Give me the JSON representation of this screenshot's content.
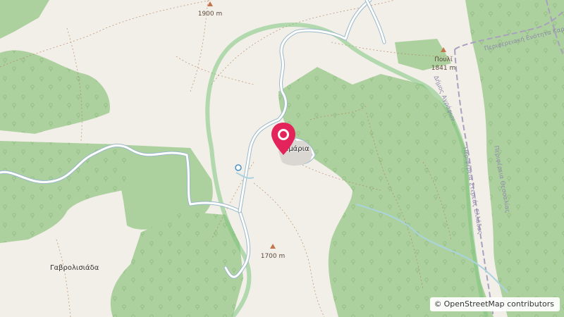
{
  "map": {
    "peaks": [
      {
        "name": "",
        "elevation": "1900 m"
      },
      {
        "name": "Πουλί",
        "elevation": "1841 m"
      },
      {
        "name": "",
        "elevation": "1700 m"
      }
    ],
    "places": [
      "Γαβρολισιάδα"
    ],
    "pin_label": "Σμάρια",
    "boundary_labels": [
      "Περιφερειακή Ενότητα Καρδίτσας",
      "Δήμος Αγράφων",
      "Περιφέρεια Θεσσαλίας",
      "Περιφέρεια Στερεάς Ελλάδας"
    ],
    "colors": {
      "background": "#f2efe9",
      "forest": "#add19e",
      "road_casing": "#9ab9ca",
      "track": "#b07c52",
      "boundary": "#a9a0bf",
      "park_border": "#7ec57e",
      "pin": "#e3245b",
      "stream": "#aad3df"
    }
  },
  "attribution": {
    "symbol": "©",
    "text": "OpenStreetMap contributors"
  }
}
